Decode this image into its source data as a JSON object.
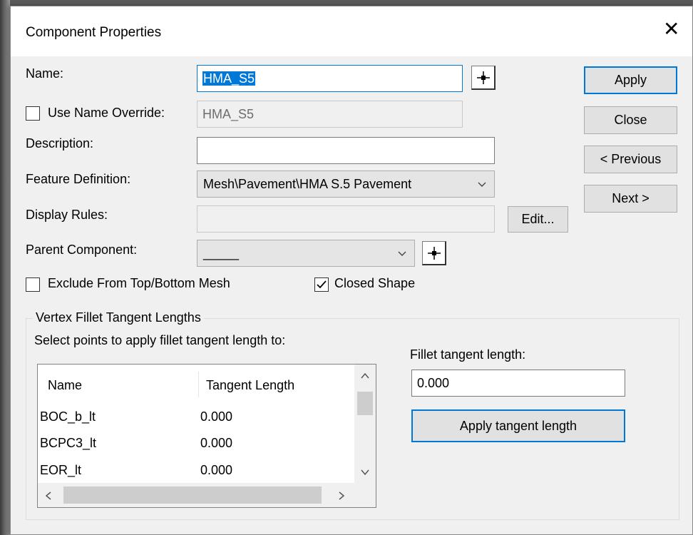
{
  "dialog": {
    "title": "Component Properties",
    "close_glyph": "✕"
  },
  "fields": {
    "name_label": "Name:",
    "name_value": "HMA_S5",
    "use_name_override_label": "Use Name Override:",
    "use_name_override_checked": false,
    "name_override_value": "HMA_S5",
    "description_label": "Description:",
    "description_value": "",
    "feature_definition_label": "Feature Definition:",
    "feature_definition_value": "Mesh\\Pavement\\HMA S.5 Pavement",
    "display_rules_label": "Display Rules:",
    "display_rules_value": "",
    "edit_button": "Edit...",
    "parent_component_label": "Parent Component:",
    "parent_component_value": "_____",
    "exclude_label": "Exclude From Top/Bottom Mesh",
    "exclude_checked": false,
    "closed_shape_label": "Closed Shape",
    "closed_shape_checked": true
  },
  "buttons": {
    "apply": "Apply",
    "close": "Close",
    "previous": "< Previous",
    "next": "Next >"
  },
  "fillet": {
    "group_title": "Vertex Fillet Tangent Lengths",
    "instruction": "Select points to apply fillet tangent length to:",
    "columns": [
      "Name",
      "Tangent Length"
    ],
    "rows": [
      {
        "name": "BOC_b_lt",
        "length": "0.000"
      },
      {
        "name": "BCPC3_lt",
        "length": "0.000"
      },
      {
        "name": "EOR_lt",
        "length": "0.000"
      }
    ],
    "tangent_label": "Fillet tangent length:",
    "tangent_value": "0.000",
    "apply_tangent_button": "Apply tangent length"
  },
  "icons": {
    "picker": "crosshair-icon",
    "dropdown": "chevron-down-icon",
    "check": "check-icon",
    "scroll_up": "chevron-up-icon",
    "scroll_down": "chevron-down-icon",
    "scroll_left": "chevron-left-icon",
    "scroll_right": "chevron-right-icon"
  },
  "colors": {
    "accent": "#0078d7",
    "dialog_bg": "#f0f0f0",
    "button_bg": "#e1e1e1"
  }
}
